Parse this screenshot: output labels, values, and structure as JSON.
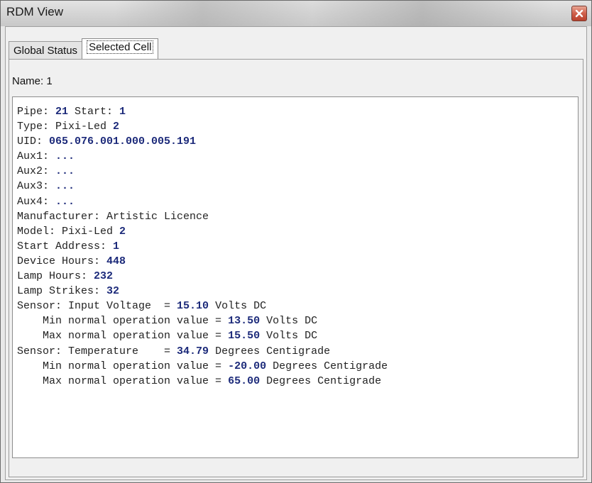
{
  "window": {
    "title": "RDM View"
  },
  "tabs": [
    {
      "label": "Global Status",
      "selected": false
    },
    {
      "label": "Selected Cell",
      "selected": true
    }
  ],
  "name_label": "Name: 1",
  "lines": [
    {
      "label": "Pipe: ",
      "value": "21",
      "rest": " Start: ",
      "value2": "1"
    },
    {
      "label": "Type: Pixi-Led ",
      "value": "2"
    },
    {
      "label": "UID: ",
      "value": "065.076.001.000.005.191"
    },
    {
      "label": "Aux1: ",
      "value": "..."
    },
    {
      "label": "Aux2: ",
      "value": "..."
    },
    {
      "label": "Aux3: ",
      "value": "..."
    },
    {
      "label": "Aux4: ",
      "value": "..."
    },
    {
      "label": "Manufacturer: Artistic Licence"
    },
    {
      "label": "Model: Pixi-Led ",
      "value": "2"
    },
    {
      "label": "Start Address: ",
      "value": "1"
    },
    {
      "label": "Device Hours: ",
      "value": "448"
    },
    {
      "label": "Lamp Hours: ",
      "value": "232"
    },
    {
      "label": "Lamp Strikes: ",
      "value": "32"
    },
    {
      "label": "Sensor: Input Voltage  = ",
      "value": "15.10",
      "rest": " Volts DC"
    },
    {
      "label": "    Min normal operation value = ",
      "value": "13.50",
      "rest": " Volts DC"
    },
    {
      "label": "    Max normal operation value = ",
      "value": "15.50",
      "rest": " Volts DC"
    },
    {
      "label": "Sensor: Temperature    = ",
      "value": "34.79",
      "rest": " Degrees Centigrade"
    },
    {
      "label": "    Min normal operation value = ",
      "value": "-20.00",
      "rest": " Degrees Centigrade"
    },
    {
      "label": "    Max normal operation value = ",
      "value": "65.00",
      "rest": " Degrees Centigrade"
    }
  ],
  "colors": {
    "value_text": "#1c2a7a",
    "close_button": "#c9503a"
  },
  "icons": {
    "close": "close-icon"
  }
}
